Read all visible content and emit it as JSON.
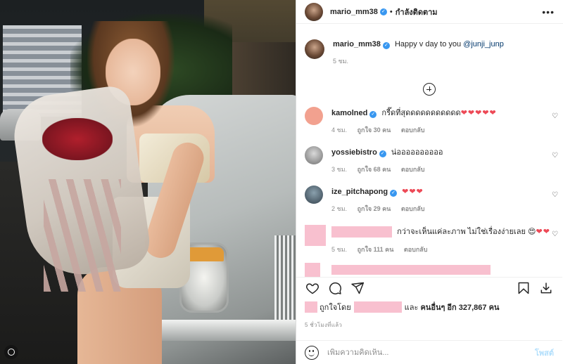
{
  "header": {
    "username": "mario_mm38",
    "follow_label": "กำลังติดตาม",
    "more_label": "•••"
  },
  "caption": {
    "username": "mario_mm38",
    "text": "Happy v day to you",
    "mention": "@junji_junp",
    "time": "5 ชม."
  },
  "comments": [
    {
      "username": "kamolned",
      "text": "กรี๊ดที่สุดดดดดดดดดดด",
      "hearts": "❤❤❤❤❤",
      "time": "4 ชม.",
      "likes": "ถูกใจ 30 คน",
      "reply": "ตอบกลับ",
      "avatar_color": "#f2a18f"
    },
    {
      "username": "yossiebistro",
      "text": "น่ออออออออออ",
      "hearts": "",
      "time": "3 ชม.",
      "likes": "ถูกใจ 68 คน",
      "reply": "ตอบกลับ",
      "avatar_color": "#8c8c8c"
    },
    {
      "username": "ize_pitchapong",
      "text": "",
      "hearts": "❤❤❤",
      "time": "2 ชม.",
      "likes": "ถูกใจ 29 คน",
      "reply": "ตอบกลับ",
      "avatar_color": "#5b7080"
    },
    {
      "username": "",
      "text": "กว่าจะเห็นแค่ละภาพ ไม่ใช่เรื่องง่ายเลย 😍",
      "hearts": "❤❤",
      "time": "5 ชม.",
      "likes": "ถูกใจ 111 คน",
      "reply": "ตอบกลับ",
      "avatar_color": "#f8c0cf"
    }
  ],
  "likes": {
    "prefix": "ถูกใจโดย",
    "middle": "และ",
    "others": "คนอื่นๆ อีก 327,867 คน"
  },
  "time_ago": "5 ชั่วโมงที่แล้ว",
  "add_comment": {
    "placeholder": "เพิ่มความคิดเห็น...",
    "post_label": "โพสต์"
  },
  "colors": {
    "verified": "#3897f0",
    "heart": "#ed4956",
    "redaction": "#f8c0cf",
    "post_disabled": "#b2dffc"
  },
  "icons": [
    "like-icon",
    "comment-icon",
    "share-icon",
    "save-icon",
    "download-icon",
    "add-comments-icon",
    "emoji-icon",
    "more-icon",
    "verified-icon",
    "heart-like-icon"
  ]
}
